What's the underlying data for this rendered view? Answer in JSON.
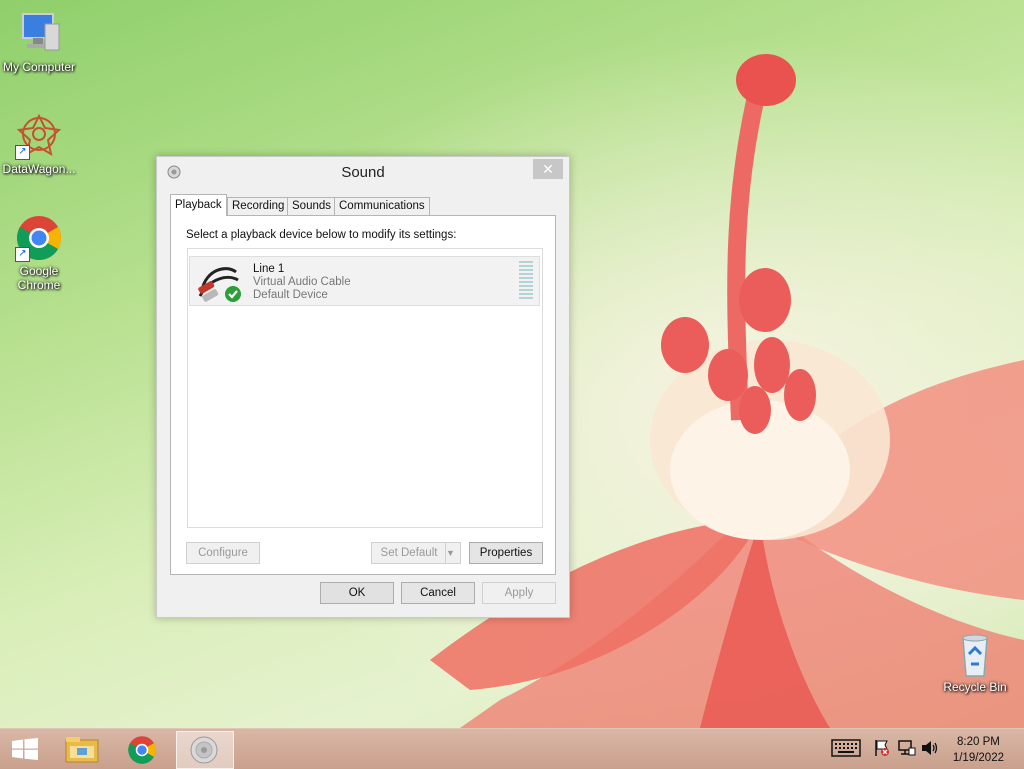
{
  "desktop": {
    "icons": [
      {
        "label": "My Computer",
        "icon": "computer-icon"
      },
      {
        "label": "DataWagon...",
        "icon": "datawagon-icon"
      },
      {
        "label": "Google Chrome",
        "icon": "chrome-icon"
      },
      {
        "label": "Recycle Bin",
        "icon": "recycle-bin-icon"
      }
    ]
  },
  "dialog": {
    "title": "Sound",
    "close_glyph": "✕",
    "tabs": [
      {
        "label": "Playback",
        "active": true
      },
      {
        "label": "Recording",
        "active": false
      },
      {
        "label": "Sounds",
        "active": false
      },
      {
        "label": "Communications",
        "active": false
      }
    ],
    "instruction": "Select a playback device below to modify its settings:",
    "devices": [
      {
        "name": "Line 1",
        "description": "Virtual Audio Cable",
        "status": "Default Device",
        "icon": "audio-cable-icon"
      }
    ],
    "buttons": {
      "configure": "Configure",
      "set_default": "Set Default",
      "properties": "Properties",
      "ok": "OK",
      "cancel": "Cancel",
      "apply": "Apply"
    }
  },
  "taskbar": {
    "items": [
      {
        "icon": "windows-start-icon"
      },
      {
        "icon": "file-explorer-icon"
      },
      {
        "icon": "chrome-icon"
      },
      {
        "icon": "speaker-icon",
        "active": true
      }
    ],
    "tray": [
      "keyboard-icon",
      "action-center-flag-icon",
      "network-icon",
      "volume-icon"
    ],
    "time": "8:20 PM",
    "date": "1/19/2022"
  },
  "colors": {
    "check_green": "#2e9e3a",
    "taskbar": "#c9a08c"
  }
}
